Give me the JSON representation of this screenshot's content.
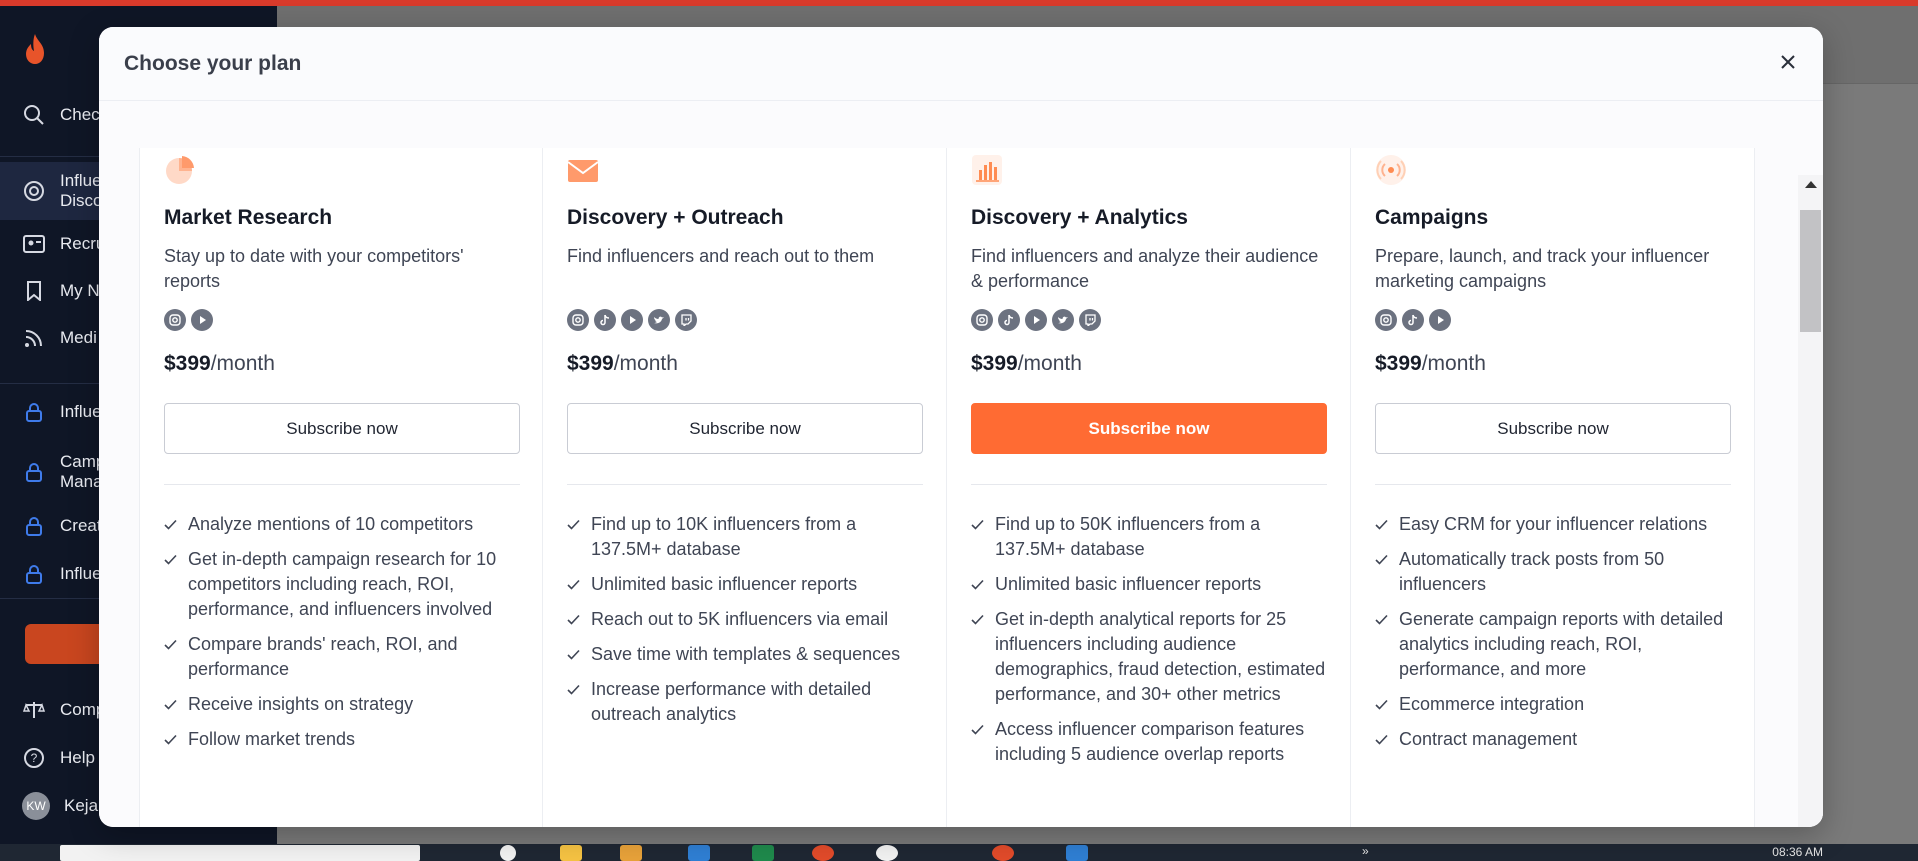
{
  "sidebar": {
    "items": [
      {
        "label": "Chec",
        "icon": "search-icon"
      },
      {
        "label": "Influe\nDisco",
        "icon": "target-icon"
      },
      {
        "label": "Recru",
        "icon": "id-card-icon"
      },
      {
        "label": "My N",
        "icon": "bookmark-icon"
      },
      {
        "label": "Medi",
        "icon": "rss-icon"
      },
      {
        "label": "Influe",
        "icon": "lock-icon"
      },
      {
        "label": "Camp\nMana",
        "icon": "lock-icon"
      },
      {
        "label": "Creat",
        "icon": "lock-icon"
      },
      {
        "label": "Influe",
        "icon": "lock-icon"
      },
      {
        "label": "Comp",
        "icon": "scale-icon"
      },
      {
        "label": "Help",
        "icon": "help-icon"
      },
      {
        "label": "Kejah",
        "icon": "avatar"
      }
    ],
    "avatar_initials": "KW"
  },
  "modal": {
    "title": "Choose your plan",
    "plans": [
      {
        "name": "Market Research",
        "description": "Stay up to date with your competitors' reports",
        "icon": "pie-chart-icon",
        "socials": [
          "instagram",
          "youtube"
        ],
        "price": "$399",
        "period": "/month",
        "button": "Subscribe now",
        "highlighted": false,
        "features": [
          "Analyze mentions of 10 competitors",
          "Get in-depth campaign research for 10 competitors including reach, ROI, performance, and influencers involved",
          "Compare brands' reach, ROI, and performance",
          "Receive insights on strategy",
          "Follow market trends"
        ]
      },
      {
        "name": "Discovery + Outreach",
        "description": "Find influencers and reach out to them",
        "icon": "envelope-icon",
        "socials": [
          "instagram",
          "tiktok",
          "youtube",
          "twitter",
          "twitch"
        ],
        "price": "$399",
        "period": "/month",
        "button": "Subscribe now",
        "highlighted": false,
        "features": [
          "Find up to 10K influencers from a 137.5M+ database",
          "Unlimited basic influencer reports",
          "Reach out to 5K influencers via email",
          "Save time with templates & sequences",
          "Increase performance with detailed outreach analytics"
        ]
      },
      {
        "name": "Discovery + Analytics",
        "description": "Find influencers and analyze their audience & performance",
        "icon": "bar-chart-icon",
        "socials": [
          "instagram",
          "tiktok",
          "youtube",
          "twitter",
          "twitch"
        ],
        "price": "$399",
        "period": "/month",
        "button": "Subscribe now",
        "highlighted": true,
        "features": [
          "Find up to 50K influencers from a 137.5M+ database",
          "Unlimited basic influencer reports",
          "Get in-depth analytical reports for 25 influencers including audience demographics, fraud detection, estimated performance, and 30+ other metrics",
          "Access influencer comparison features including 5 audience overlap reports"
        ]
      },
      {
        "name": "Campaigns",
        "description": "Prepare, launch, and track your influencer marketing campaigns",
        "icon": "broadcast-icon",
        "socials": [
          "instagram",
          "tiktok",
          "youtube"
        ],
        "price": "$399",
        "period": "/month",
        "button": "Subscribe now",
        "highlighted": false,
        "features": [
          "Easy CRM for your influencer relations",
          "Automatically track posts from 50 influencers",
          "Generate campaign reports with detailed analytics including reach, ROI, performance, and more",
          "Ecommerce integration",
          "Contract management"
        ]
      }
    ]
  },
  "taskbar": {
    "time": "08:36 AM"
  },
  "colors": {
    "accent": "#ff6b33",
    "sidebar_bg": "#0f1626",
    "plan_icon": "#ffb38f"
  }
}
